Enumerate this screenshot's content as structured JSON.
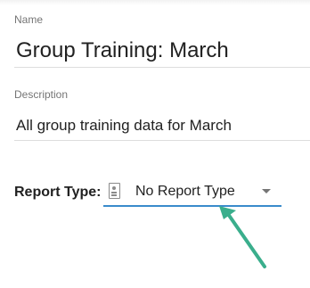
{
  "form": {
    "name_label": "Name",
    "name_value": "Group Training: March",
    "description_label": "Description",
    "description_value": "All group training data for March",
    "report_type_label": "Report Type:",
    "report_type_value": "No Report Type"
  },
  "colors": {
    "select_underline": "#3a8bcb",
    "annotation_arrow": "#3aae8c"
  },
  "icons": {
    "report_type_icon": "contact-document-icon",
    "dropdown_icon": "caret-down-icon",
    "annotation": "pointer-arrow-icon"
  }
}
